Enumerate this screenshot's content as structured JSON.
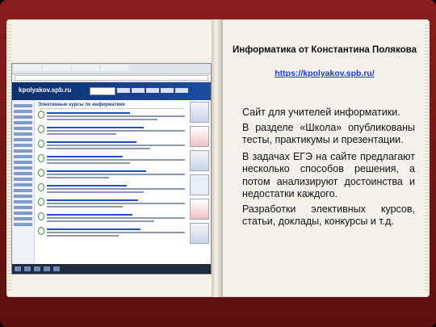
{
  "book": {
    "heading": "Информатика от Константина Полякова",
    "link": "https://kpolyakov.spb.ru/"
  },
  "screenshot": {
    "site_logo": "kpolyakov.spb.ru",
    "section_title": "Элективные курсы по информатике"
  },
  "bullets": [
    "Сайт для учителей информатики.",
    "В разделе «Школа» опубликованы тесты, практикумы и презентации.",
    "В задачах ЕГЭ на сайте предлагают несколько способов решения, а потом анализируют достоинства и недостатки каждого.",
    "Разработки элективных курсов, статьи, доклады, конкурсы и т.д."
  ],
  "bullet_mark": "",
  "colors": {
    "cover": "#7a1616",
    "page": "#f4f1ea",
    "link": "#1b3fb8"
  }
}
